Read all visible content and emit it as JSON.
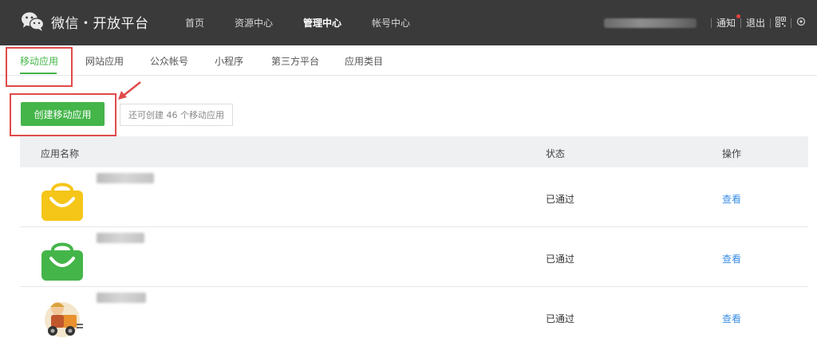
{
  "header": {
    "brand": "微信・开放平台",
    "nav": [
      {
        "label": "首页",
        "active": false
      },
      {
        "label": "资源中心",
        "active": false
      },
      {
        "label": "管理中心",
        "active": true
      },
      {
        "label": "帐号中心",
        "active": false
      }
    ],
    "notify_label": "通知",
    "logout_label": "退出",
    "icons": {
      "brand": "wechat-logo-icon",
      "qr": "qrcode-icon",
      "settings": "settings-icon"
    }
  },
  "subnav": {
    "tabs": [
      {
        "label": "移动应用",
        "active": true
      },
      {
        "label": "网站应用",
        "active": false
      },
      {
        "label": "公众帐号",
        "active": false
      },
      {
        "label": "小程序",
        "active": false
      },
      {
        "label": "第三方平台",
        "active": false
      },
      {
        "label": "应用类目",
        "active": false
      }
    ]
  },
  "create": {
    "button_label": "创建移动应用",
    "quota_text": "还可创建 46 个移动应用"
  },
  "table": {
    "columns": [
      "应用名称",
      "状态",
      "操作"
    ],
    "rows": [
      {
        "status": "已通过",
        "action": "查看",
        "icon": "yellow-shopping-bag-icon"
      },
      {
        "status": "已通过",
        "action": "查看",
        "icon": "green-shopping-bag-icon"
      },
      {
        "status": "已通过",
        "action": "查看",
        "icon": "delivery-courier-icon"
      }
    ]
  },
  "colors": {
    "topbar": "#3a3a3a",
    "accent_green": "#44b549",
    "link_blue": "#3a8ee6",
    "highlight_red": "#e04a4a",
    "bag_yellow": "#f5c518",
    "bag_green": "#44b549"
  }
}
